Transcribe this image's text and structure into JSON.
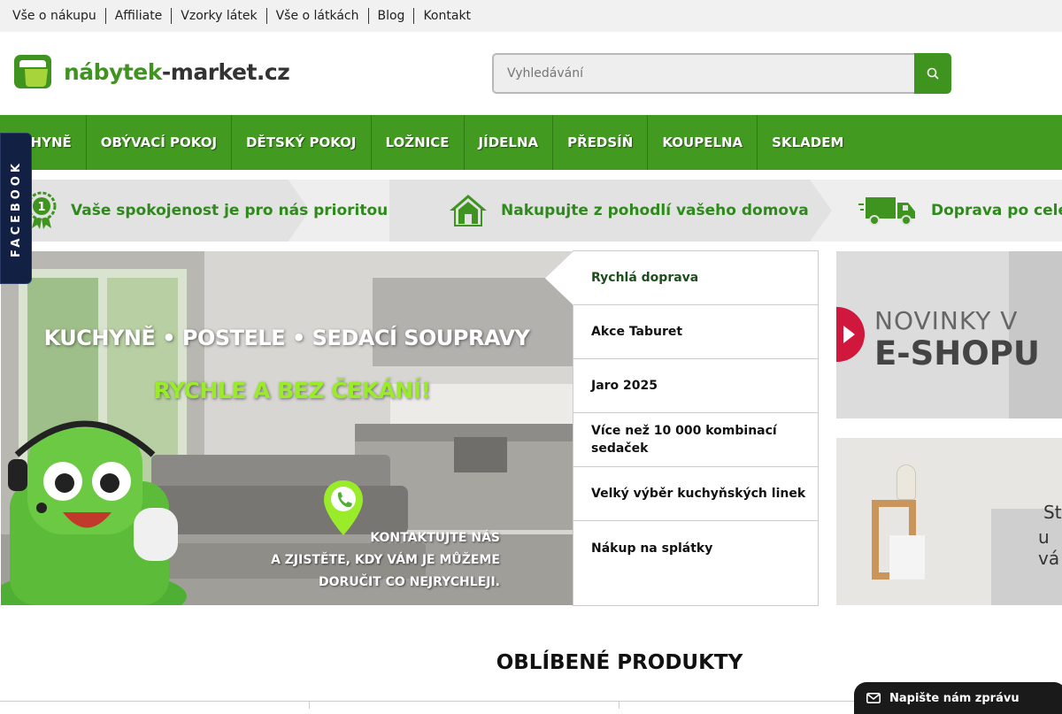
{
  "topbar": {
    "links": [
      "Vše o nákupu",
      "Affiliate",
      "Vzorky látek",
      "Vše o látkách",
      "Blog",
      "Kontakt"
    ]
  },
  "logo": {
    "text_green": "nábytek",
    "text_dark": "-market.cz"
  },
  "search": {
    "placeholder": "Vyhledávání"
  },
  "nav": {
    "items": [
      "KUCHYNĚ",
      "OBÝVACÍ POKOJ",
      "DĚTSKÝ POKOJ",
      "LOŽNICE",
      "JÍDELNA",
      "PŘEDSÍŇ",
      "KOUPELNA",
      "SKLADEM"
    ]
  },
  "benefits": [
    {
      "text": "Vaše spokojenost je pro nás prioritou",
      "icon": "award-badge-icon"
    },
    {
      "text": "Nakupujte z pohodlí vašeho domova",
      "icon": "house-icon"
    },
    {
      "text": "Doprava po celé",
      "icon": "truck-icon"
    }
  ],
  "facebook": {
    "label": "FACEBOOK"
  },
  "hero": {
    "line1": "KUCHYNĚ • POSTELE • SEDACÍ SOUPRAVY",
    "line2": "RYCHLE A BEZ ČEKÁNÍ!",
    "contact1": "KONTAKTUJTE NÁS",
    "contact2": "A ZJISTĚTE, KDY VÁM JE MŮŽEME",
    "contact3": "DORUČIT CO NEJRYCHLEJI."
  },
  "tabs": [
    "Rychlá doprava",
    "Akce Taburet",
    "Jaro 2025",
    "Více než 10 000 kombinací sedaček",
    "Velký výběr kuchyňských linek",
    "Nákup na splátky"
  ],
  "promo1": {
    "line1": "NOVINKY V",
    "line2": "E-SHOPU"
  },
  "promo2": {
    "line1": "St",
    "line2": "u vá"
  },
  "section": {
    "title": "OBLÍBENÉ PRODUKTY"
  },
  "chat": {
    "label": "Napište nám zprávu"
  },
  "colors": {
    "brand_green": "#429a21",
    "dark_navy": "#112043",
    "promo_red": "#d0173c"
  }
}
